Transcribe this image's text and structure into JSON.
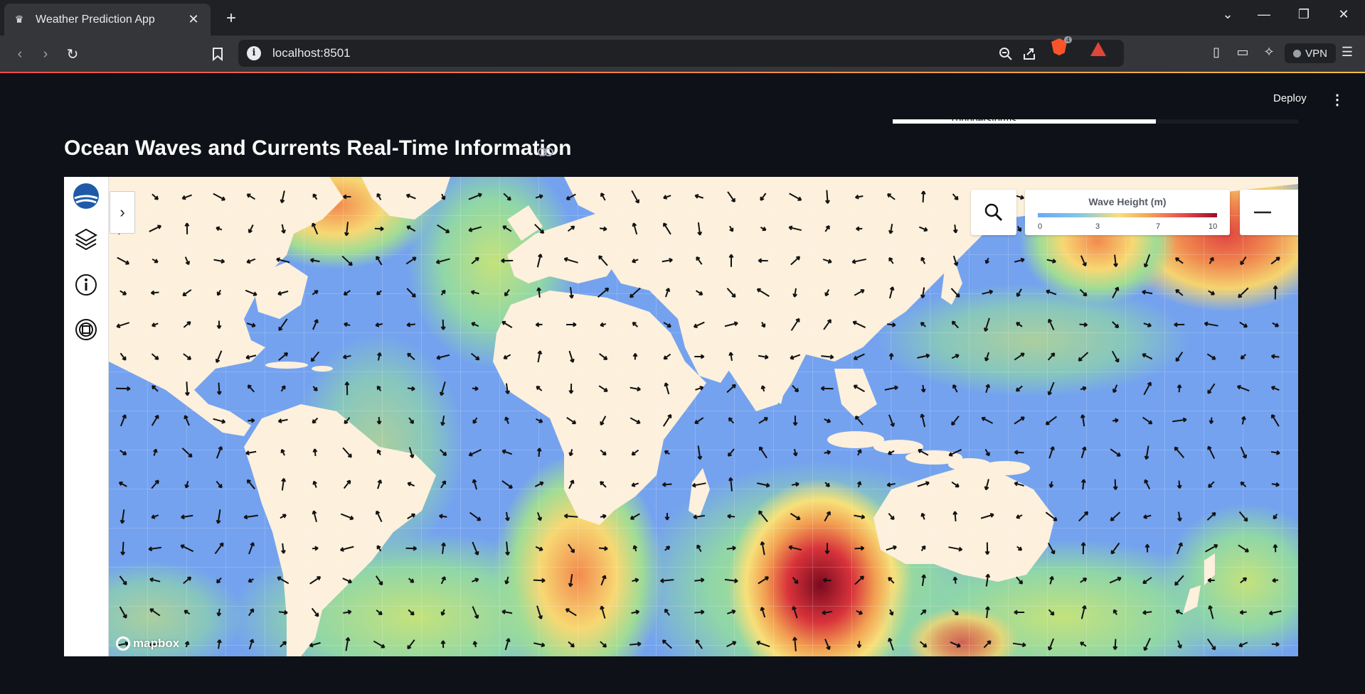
{
  "browser": {
    "tab_title": "Weather Prediction App",
    "url": "localhost:8501",
    "brave_count": "4",
    "vpn_label": "VPN"
  },
  "app": {
    "deploy_label": "Deploy",
    "previous_chart_snippet": "Thunderstorms",
    "heading": "Ocean Waves and Currents Real-Time Information"
  },
  "map": {
    "legend_title": "Wave Height (m)",
    "legend_ticks": [
      "0",
      "3",
      "7",
      "10"
    ],
    "attribution": "mapbox",
    "colors": {
      "ocean_low": "#6aa9f5",
      "ocean_mid": "#7fc6e8",
      "wave_mid": "#f7e07a",
      "wave_high": "#e5484d",
      "wave_max": "#9b0d2a",
      "land": "#fdf0dc"
    },
    "sidebar_icons": [
      "noaa-logo-icon",
      "layers-icon",
      "info-icon",
      "target-icon"
    ]
  }
}
